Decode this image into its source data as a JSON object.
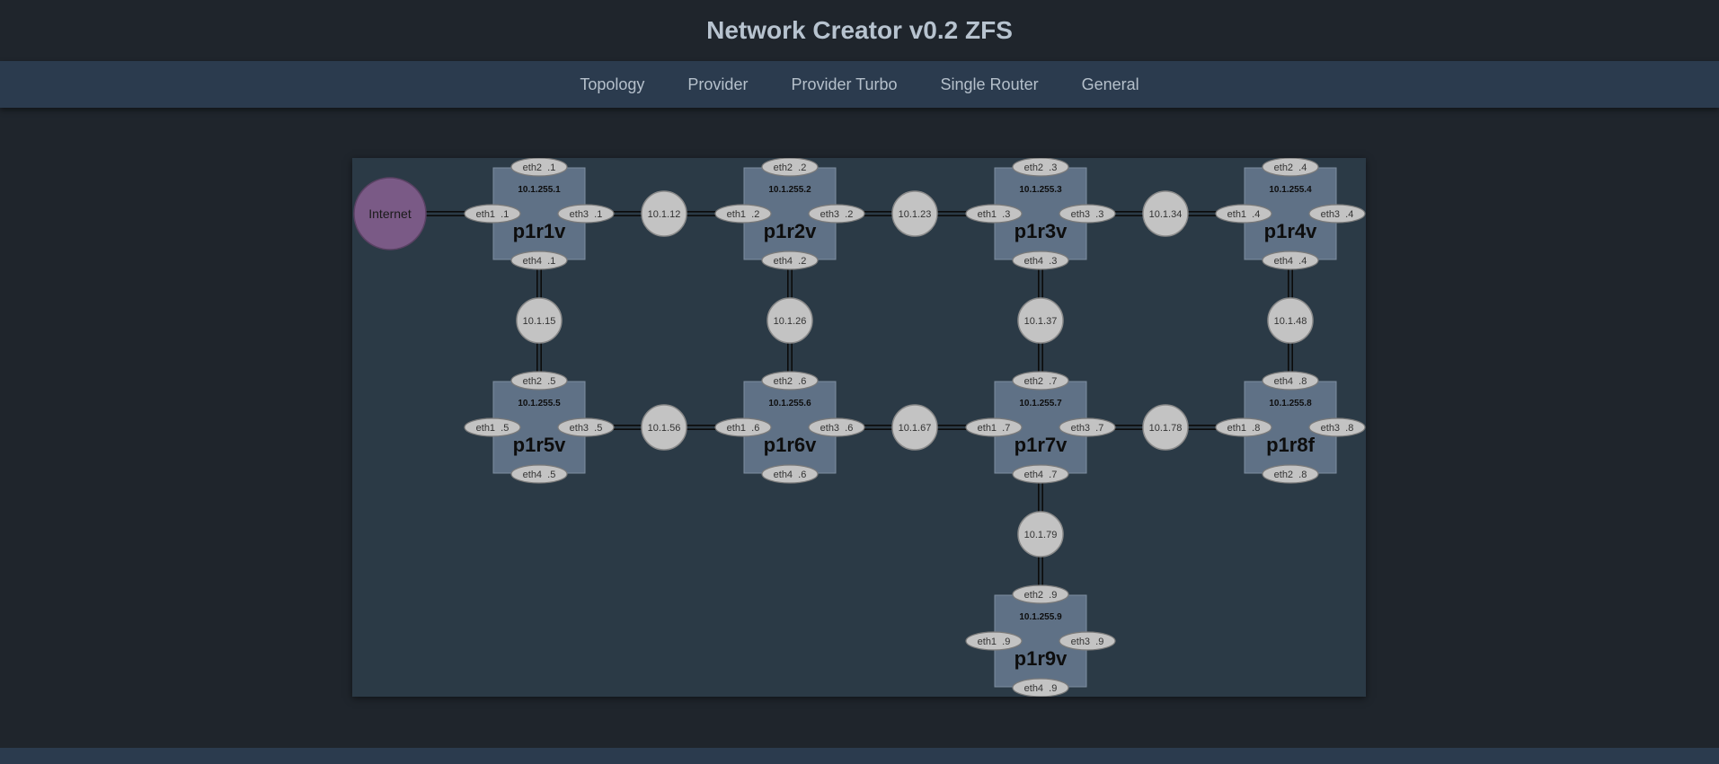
{
  "app": {
    "title": "Network Creator v0.2 ZFS"
  },
  "nav": {
    "items": [
      {
        "label": "Topology"
      },
      {
        "label": "Provider"
      },
      {
        "label": "Provider Turbo"
      },
      {
        "label": "Single Router"
      },
      {
        "label": "General"
      }
    ]
  },
  "colors": {
    "router_fill": "#5f7186",
    "port_fill": "#c3c3c3",
    "subnet_fill": "#c3c3c3",
    "internet_fill": "#7a5a86",
    "link": "#0b0b0b"
  },
  "topology": {
    "internet": {
      "label": "Internet"
    },
    "routers": [
      {
        "id": "p1r1v",
        "label": "p1r1v",
        "ip": "10.1.255.1",
        "ports": {
          "top": "eth2  .1",
          "left": "eth1  .1",
          "right": "eth3  .1",
          "bottom": "eth4  .1"
        }
      },
      {
        "id": "p1r2v",
        "label": "p1r2v",
        "ip": "10.1.255.2",
        "ports": {
          "top": "eth2  .2",
          "left": "eth1  .2",
          "right": "eth3  .2",
          "bottom": "eth4  .2"
        }
      },
      {
        "id": "p1r3v",
        "label": "p1r3v",
        "ip": "10.1.255.3",
        "ports": {
          "top": "eth2  .3",
          "left": "eth1  .3",
          "right": "eth3  .3",
          "bottom": "eth4  .3"
        }
      },
      {
        "id": "p1r4v",
        "label": "p1r4v",
        "ip": "10.1.255.4",
        "ports": {
          "top": "eth2  .4",
          "left": "eth1  .4",
          "right": "eth3  .4",
          "bottom": "eth4  .4"
        }
      },
      {
        "id": "p1r5v",
        "label": "p1r5v",
        "ip": "10.1.255.5",
        "ports": {
          "top": "eth2  .5",
          "left": "eth1  .5",
          "right": "eth3  .5",
          "bottom": "eth4  .5"
        }
      },
      {
        "id": "p1r6v",
        "label": "p1r6v",
        "ip": "10.1.255.6",
        "ports": {
          "top": "eth2  .6",
          "left": "eth1  .6",
          "right": "eth3  .6",
          "bottom": "eth4  .6"
        }
      },
      {
        "id": "p1r7v",
        "label": "p1r7v",
        "ip": "10.1.255.7",
        "ports": {
          "top": "eth2  .7",
          "left": "eth1  .7",
          "right": "eth3  .7",
          "bottom": "eth4  .7"
        }
      },
      {
        "id": "p1r8f",
        "label": "p1r8f",
        "ip": "10.1.255.8",
        "ports": {
          "top": "eth4  .8",
          "left": "eth1  .8",
          "right": "eth3  .8",
          "bottom": "eth2  .8"
        }
      },
      {
        "id": "p1r9v",
        "label": "p1r9v",
        "ip": "10.1.255.9",
        "ports": {
          "top": "eth2  .9",
          "left": "eth1  .9",
          "right": "eth3  .9",
          "bottom": "eth4  .9"
        }
      }
    ],
    "subnets": [
      {
        "id": "s12",
        "label": "10.1.12"
      },
      {
        "id": "s23",
        "label": "10.1.23"
      },
      {
        "id": "s34",
        "label": "10.1.34"
      },
      {
        "id": "s15",
        "label": "10.1.15"
      },
      {
        "id": "s26",
        "label": "10.1.26"
      },
      {
        "id": "s37",
        "label": "10.1.37"
      },
      {
        "id": "s48",
        "label": "10.1.48"
      },
      {
        "id": "s56",
        "label": "10.1.56"
      },
      {
        "id": "s67",
        "label": "10.1.67"
      },
      {
        "id": "s78",
        "label": "10.1.78"
      },
      {
        "id": "s79",
        "label": "10.1.79"
      }
    ]
  }
}
